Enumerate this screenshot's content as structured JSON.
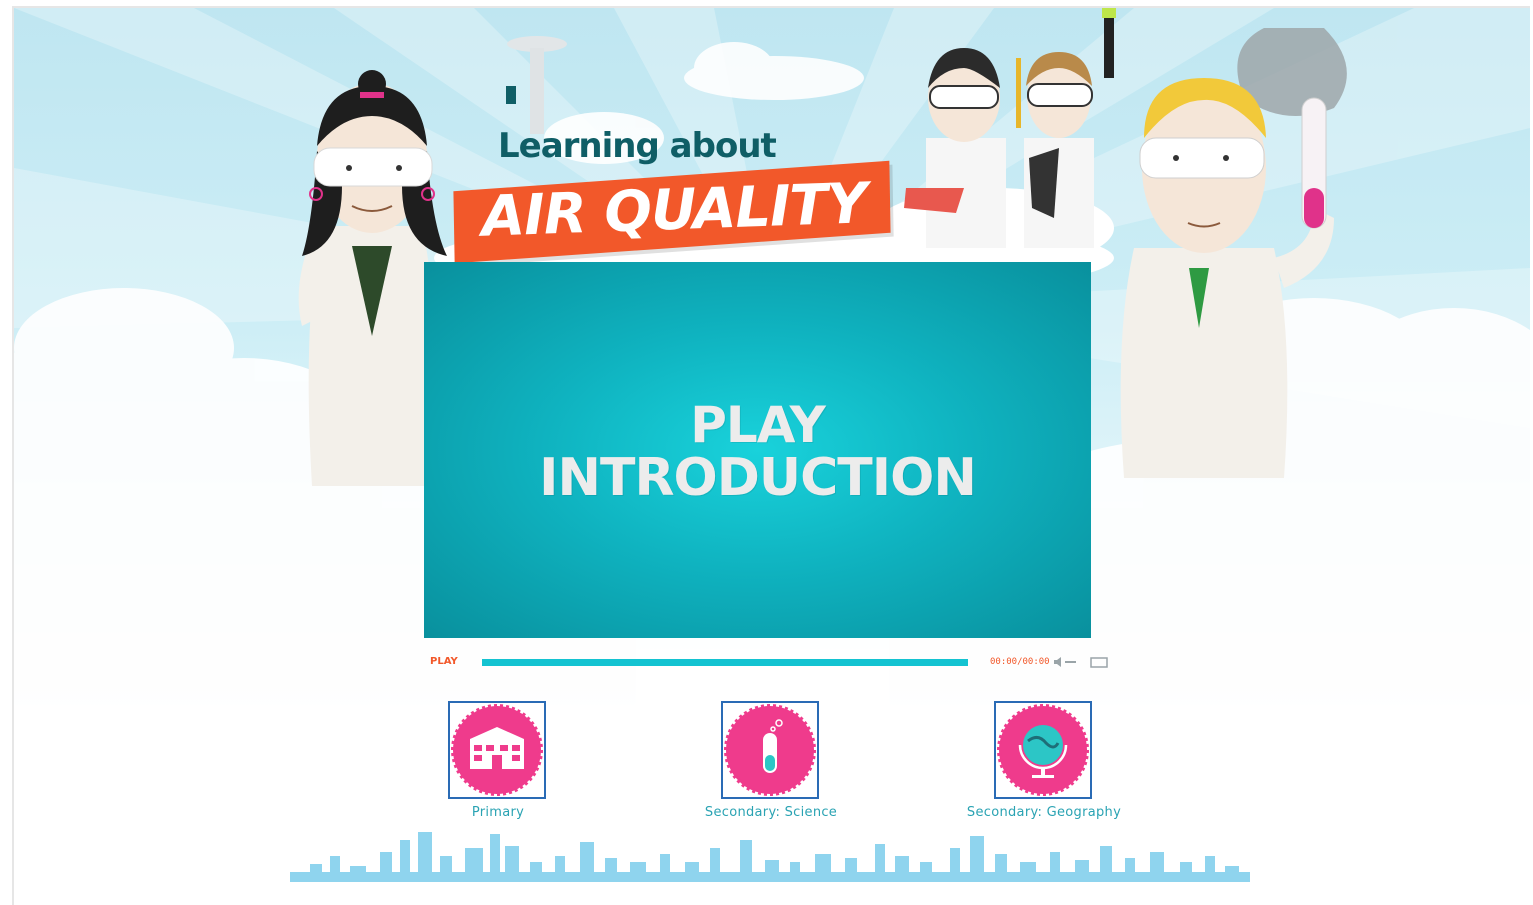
{
  "header": {
    "title_top": "Learning about",
    "title_main": "AIR QUALITY"
  },
  "video": {
    "line1": "PLAY",
    "line2": "INTRODUCTION",
    "controls": {
      "play_label": "PLAY",
      "time": "00:00/00:00",
      "progress_fraction": 1.0
    }
  },
  "levels": [
    {
      "label": "Primary",
      "icon": "school-icon"
    },
    {
      "label": "Secondary: Science",
      "icon": "test-tube-icon"
    },
    {
      "label": "Secondary: Geography",
      "icon": "globe-icon"
    }
  ],
  "colors": {
    "brand_orange": "#f2582a",
    "brand_teal": "#0f5e66",
    "video_teal": "#10b6c2",
    "badge_pink": "#ef3b8c",
    "badge_border": "#2a6bb5",
    "label_teal": "#2aa3b3"
  }
}
